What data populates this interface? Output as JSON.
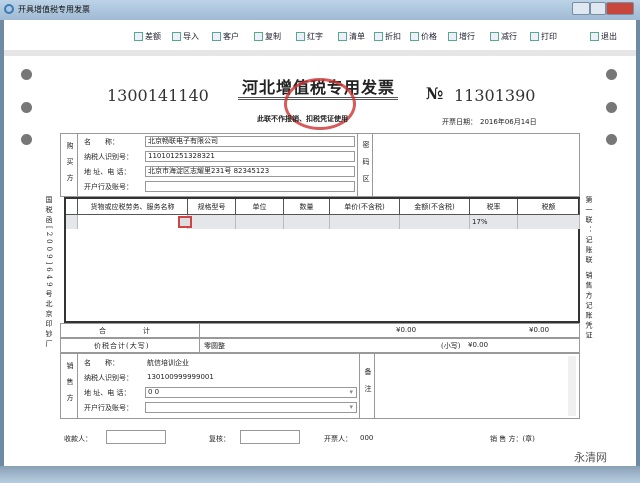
{
  "window": {
    "title": "开具增值税专用发票"
  },
  "toolbar": {
    "items": [
      {
        "label": "差额",
        "icon": "diff-icon"
      },
      {
        "label": "导入",
        "icon": "import-icon"
      },
      {
        "label": "客户",
        "icon": "customer-icon"
      },
      {
        "label": "复制",
        "icon": "copy-icon"
      },
      {
        "label": "红字",
        "icon": "red-invoice-icon"
      },
      {
        "label": "清单",
        "icon": "list-icon"
      },
      {
        "label": "折扣",
        "icon": "discount-icon"
      },
      {
        "label": "价格",
        "icon": "price-icon"
      },
      {
        "label": "增行",
        "icon": "add-row-icon"
      },
      {
        "label": "减行",
        "icon": "remove-row-icon"
      },
      {
        "label": "打印",
        "icon": "print-icon"
      },
      {
        "label": "退出",
        "icon": "exit-icon"
      }
    ]
  },
  "invoice": {
    "code": "1300141140",
    "title": "河北增值税专用发票",
    "no_symbol": "№",
    "number": "11301390",
    "subtitle": "此联不作报销、扣税凭证使用",
    "date_label": "开票日期：",
    "date": "2016年06月14日",
    "left_side": "国税函[2009]649号北京印钞厂",
    "right_side": "第一联：记账联 销售方记账凭证",
    "buyer": {
      "section": "购买方",
      "name_label": "名　　称：",
      "name": "北京畅联电子有限公司",
      "taxid_label": "纳税人识别号：",
      "taxid": "110101251328321",
      "addr_label": "地 址、电 话：",
      "addr": "北京市海淀区志耀里231号 82345123",
      "bank_label": "开户行及账号：",
      "bank": ""
    },
    "cipher_label": "密码区",
    "columns": [
      "货物或应税劳务、服务名称",
      "规格型号",
      "单位",
      "数量",
      "单价(不含税)",
      "金额(不含税)",
      "税率",
      "税额"
    ],
    "rows": [
      [
        "",
        "",
        "",
        "",
        "",
        "",
        "17%",
        ""
      ]
    ],
    "total_label": "合　　　计",
    "total_amount": "¥0.00",
    "total_tax": "¥0.00",
    "grand_label": "价税合计(大写)",
    "grand_upper": "零圆整",
    "grand_lower_label": "(小写)",
    "grand_lower": "¥0.00",
    "seller": {
      "section": "销售方",
      "name_label": "名　　称：",
      "name": "航信培训企业",
      "taxid_label": "纳税人识别号：",
      "taxid": "130100999999001",
      "addr_label": "地 址、电 话：",
      "addr": "0 0",
      "bank_label": "开户行及账号：",
      "bank": ""
    },
    "remark_label": "备注",
    "payee_label": "收款人：",
    "payee": "",
    "reviewer_label": "复核：",
    "reviewer": "",
    "drawer_label": "开票人：",
    "drawer": "000",
    "seller_seal_label": "销 售 方：(章)"
  },
  "watermark": "永清网"
}
